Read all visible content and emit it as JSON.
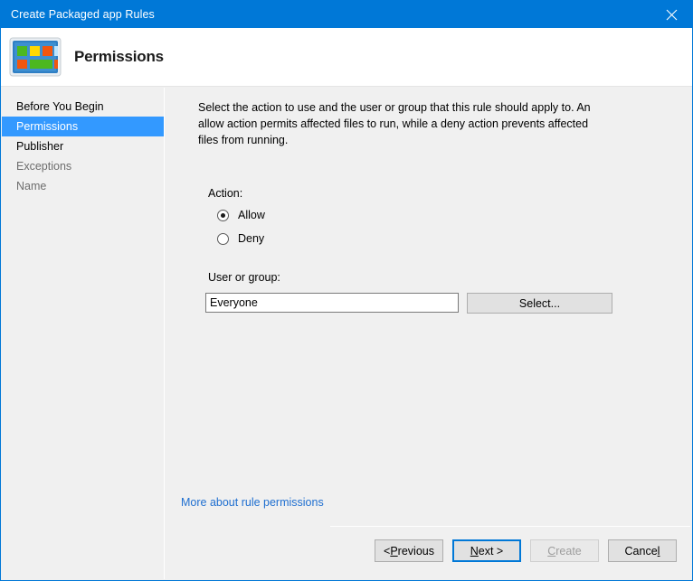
{
  "window": {
    "title": "Create Packaged app Rules",
    "close_icon": "close-icon",
    "accent_color": "#0078d7",
    "selection_color": "#3399ff",
    "background_color": "#f0f0f0"
  },
  "header": {
    "heading": "Permissions",
    "icon": "packaged-app-rules-icon"
  },
  "sidebar": {
    "items": [
      {
        "label": "Before You Begin",
        "state": "normal"
      },
      {
        "label": "Permissions",
        "state": "selected"
      },
      {
        "label": "Publisher",
        "state": "normal"
      },
      {
        "label": "Exceptions",
        "state": "disabled"
      },
      {
        "label": "Name",
        "state": "disabled"
      }
    ]
  },
  "main": {
    "description": "Select the action to use and the user or group that this rule should apply to. An allow action permits affected files to run, while a deny action prevents affected files from running.",
    "action": {
      "label": "Action:",
      "options": [
        {
          "label": "Allow",
          "checked": true
        },
        {
          "label": "Deny",
          "checked": false
        }
      ]
    },
    "user_or_group": {
      "label": "User or group:",
      "value": "Everyone",
      "placeholder": "",
      "select_button": "Select..."
    },
    "help_link": "More about rule permissions"
  },
  "footer": {
    "buttons": [
      {
        "name": "previous",
        "prefix": "< ",
        "accel": "P",
        "suffix": "revious",
        "state": "enabled"
      },
      {
        "name": "next",
        "prefix": "",
        "accel": "N",
        "suffix": "ext >",
        "state": "default"
      },
      {
        "name": "create",
        "prefix": "",
        "accel": "C",
        "suffix": "reate",
        "state": "disabled"
      },
      {
        "name": "cancel",
        "prefix": "Cance",
        "accel": "l",
        "suffix": "",
        "state": "enabled"
      }
    ]
  }
}
